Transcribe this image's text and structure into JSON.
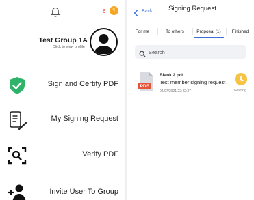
{
  "left_panel": {
    "notification_count": "6",
    "badge_count": "1",
    "profile": {
      "name": "Test Group 1A",
      "subtitle": "Click to view profile"
    },
    "menu": [
      {
        "label": "Sign and Certify PDF",
        "icon": "shield-check-icon"
      },
      {
        "label": "My Signing Request",
        "icon": "document-pen-icon"
      },
      {
        "label": "Verify PDF",
        "icon": "scan-search-icon"
      },
      {
        "label": "Invite User To Group",
        "icon": "add-user-icon"
      }
    ]
  },
  "right_panel": {
    "back_label": "Back",
    "title": "Signing Request",
    "tabs": [
      {
        "label": "For me",
        "active": false
      },
      {
        "label": "To others",
        "active": false
      },
      {
        "label": "Proposal (1)",
        "active": true
      },
      {
        "label": "Finished",
        "active": false
      }
    ],
    "search": {
      "placeholder": "Search",
      "value": ""
    },
    "documents": [
      {
        "name": "Blank 2.pdf",
        "description": "Test member signing request",
        "timestamp": "04/07/2021 22:42:37",
        "status": "Waiting",
        "file_type_label": "PDF"
      }
    ]
  },
  "colors": {
    "accent_blue": "#3d6fdb",
    "shield_green": "#2fb36a",
    "badge_orange": "#f5a623",
    "waiting_yellow": "#f6c343",
    "pdf_red": "#e5533b"
  }
}
